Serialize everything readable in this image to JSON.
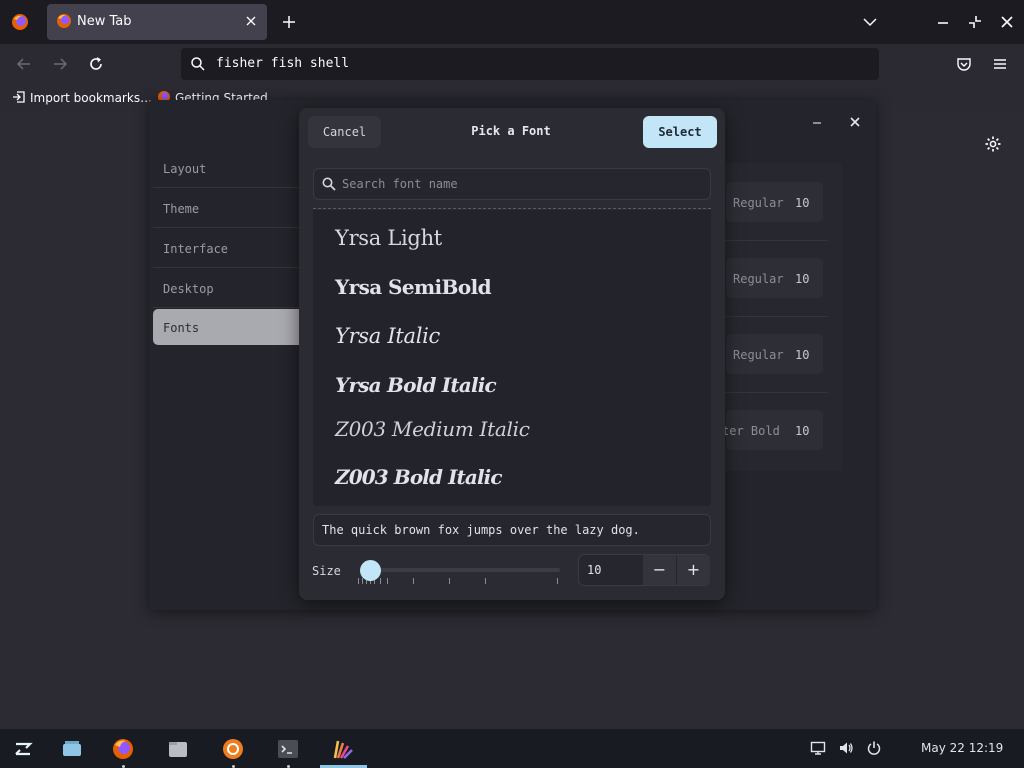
{
  "browser": {
    "tab_title": "New Tab",
    "url_text": "fisher fish shell",
    "bookmarks": [
      "Import bookmarks…",
      "Getting Started"
    ]
  },
  "settings": {
    "nav_items": [
      "Layout",
      "Theme",
      "Interface",
      "Desktop",
      "Fonts"
    ],
    "active_nav": "Fonts",
    "font_rows": [
      {
        "label": "Regular",
        "size": "10"
      },
      {
        "label": "Regular",
        "size": "10"
      },
      {
        "label": "Regular",
        "size": "10"
      },
      {
        "label": "ter Bold",
        "size": "10"
      }
    ]
  },
  "dialog": {
    "title": "Pick a Font",
    "cancel_label": "Cancel",
    "select_label": "Select",
    "search_placeholder": "Search font name",
    "fonts": [
      "Yrsa Light",
      "Yrsa SemiBold",
      "Yrsa Italic",
      "Yrsa Bold Italic",
      "Z003 Medium Italic",
      "Z003 Bold Italic"
    ],
    "preview_text": "The quick brown fox jumps over the lazy dog.",
    "size_label": "Size",
    "size_value": "10",
    "slider_level": 0.04,
    "minus_label": "−",
    "plus_label": "+"
  },
  "taskbar": {
    "apps": [
      "zorin-menu-icon",
      "workspaces-icon",
      "firefox-icon",
      "files-icon",
      "software-icon",
      "terminal-icon",
      "appearance-icon"
    ],
    "active_app": "appearance-icon",
    "clock": "May 22 12:19"
  },
  "colors": {
    "accent": "#c2e5f7",
    "dialog_bg": "#2b2b33",
    "taskbar_bg": "#191b23"
  }
}
